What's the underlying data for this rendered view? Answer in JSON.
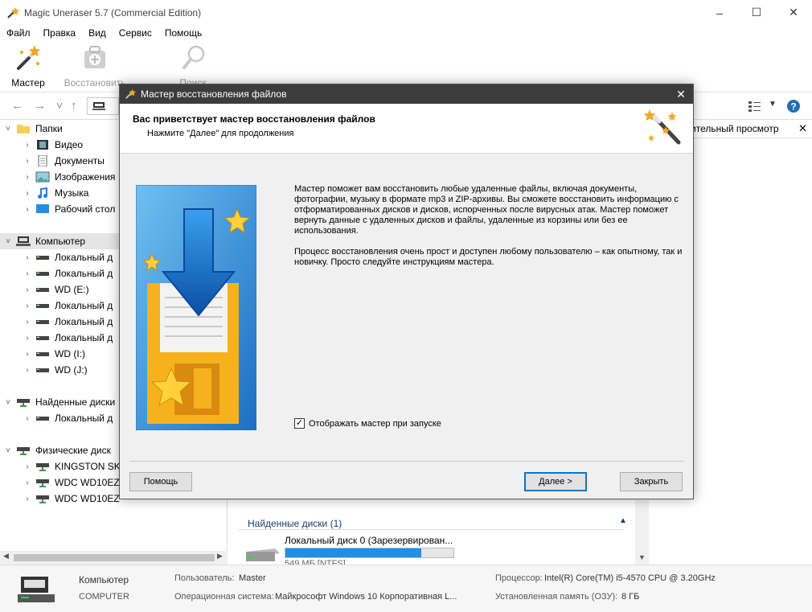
{
  "window": {
    "title": "Magic Uneraser 5.7 (Commercial Edition)",
    "controls": [
      "minimize",
      "maximize",
      "close"
    ]
  },
  "menu": [
    "Файл",
    "Правка",
    "Вид",
    "Сервис",
    "Помощь"
  ],
  "toolbar": {
    "wizard_label": "Мастер",
    "restore_label": "Восстановить",
    "search_label": "Поиск"
  },
  "tree": {
    "folders_label": "Папки",
    "folders": [
      "Видео",
      "Документы",
      "Изображения",
      "Музыка",
      "Рабочий стол"
    ],
    "computer_label": "Компьютер",
    "drives": [
      "Локальный д",
      "Локальный д",
      "WD (E:)",
      "Локальный д",
      "Локальный д",
      "Локальный д",
      "WD (I:)",
      "WD (J:)"
    ],
    "found_label": "Найденные диски",
    "found_drives": [
      "Локальный д"
    ],
    "physical_label": "Физические диск",
    "physical_drives": [
      "KINGSTON SK",
      "WDC WD10EZ",
      "WDC WD10EZ"
    ]
  },
  "preview": {
    "header": "ительный просмотр"
  },
  "found_panel": {
    "header": "Найденные диски (1)",
    "disk_name": "Локальный диск 0 (Зарезервирован...",
    "disk_fill": 0.81,
    "disk_info": "549 МБ [NTFS]"
  },
  "status": {
    "computer_label": "Компьютер",
    "computer_sub": "COMPUTER",
    "user_label": "Пользователь:",
    "user_value": "Master",
    "os_label": "Операционная система:",
    "os_value": "Майкрософт Windows 10 Корпоративная L...",
    "cpu_label": "Процессор:",
    "cpu_value": "Intel(R) Core(TM) i5-4570 CPU @ 3.20GHz",
    "ram_label": "Установленная память (ОЗУ):",
    "ram_value": "8 ГБ"
  },
  "dialog": {
    "title": "Мастер восстановления файлов",
    "heading": "Вас приветствует мастер восстановления файлов",
    "subheading": "Нажмите \"Далее\" для продолжения",
    "paragraph1": "Мастер поможет вам восстановить любые удаленные файлы, включая документы, фотографии, музыку в формате mp3 и ZIP-архивы. Вы сможете восстановить информацию с отформатированных дисков и дисков, испорченных после вирусных атак. Мастер поможет вернуть данные с удаленных дисков и файлы, удаленные из корзины или без ее использования.",
    "paragraph2": "Процесс восстановления очень прост и доступен любому пользователю – как опытному, так и новичку. Просто следуйте инструкциям мастера.",
    "checkbox_label": "Отображать мастер при запуске",
    "checkbox_checked": true,
    "help_button": "Помощь",
    "next_button": "Далее >",
    "close_button": "Закрыть"
  },
  "colors": {
    "dialog_title_bg": "#3c3c3c",
    "accent": "#0078d7",
    "progress_fill": "#1f8fe5"
  }
}
